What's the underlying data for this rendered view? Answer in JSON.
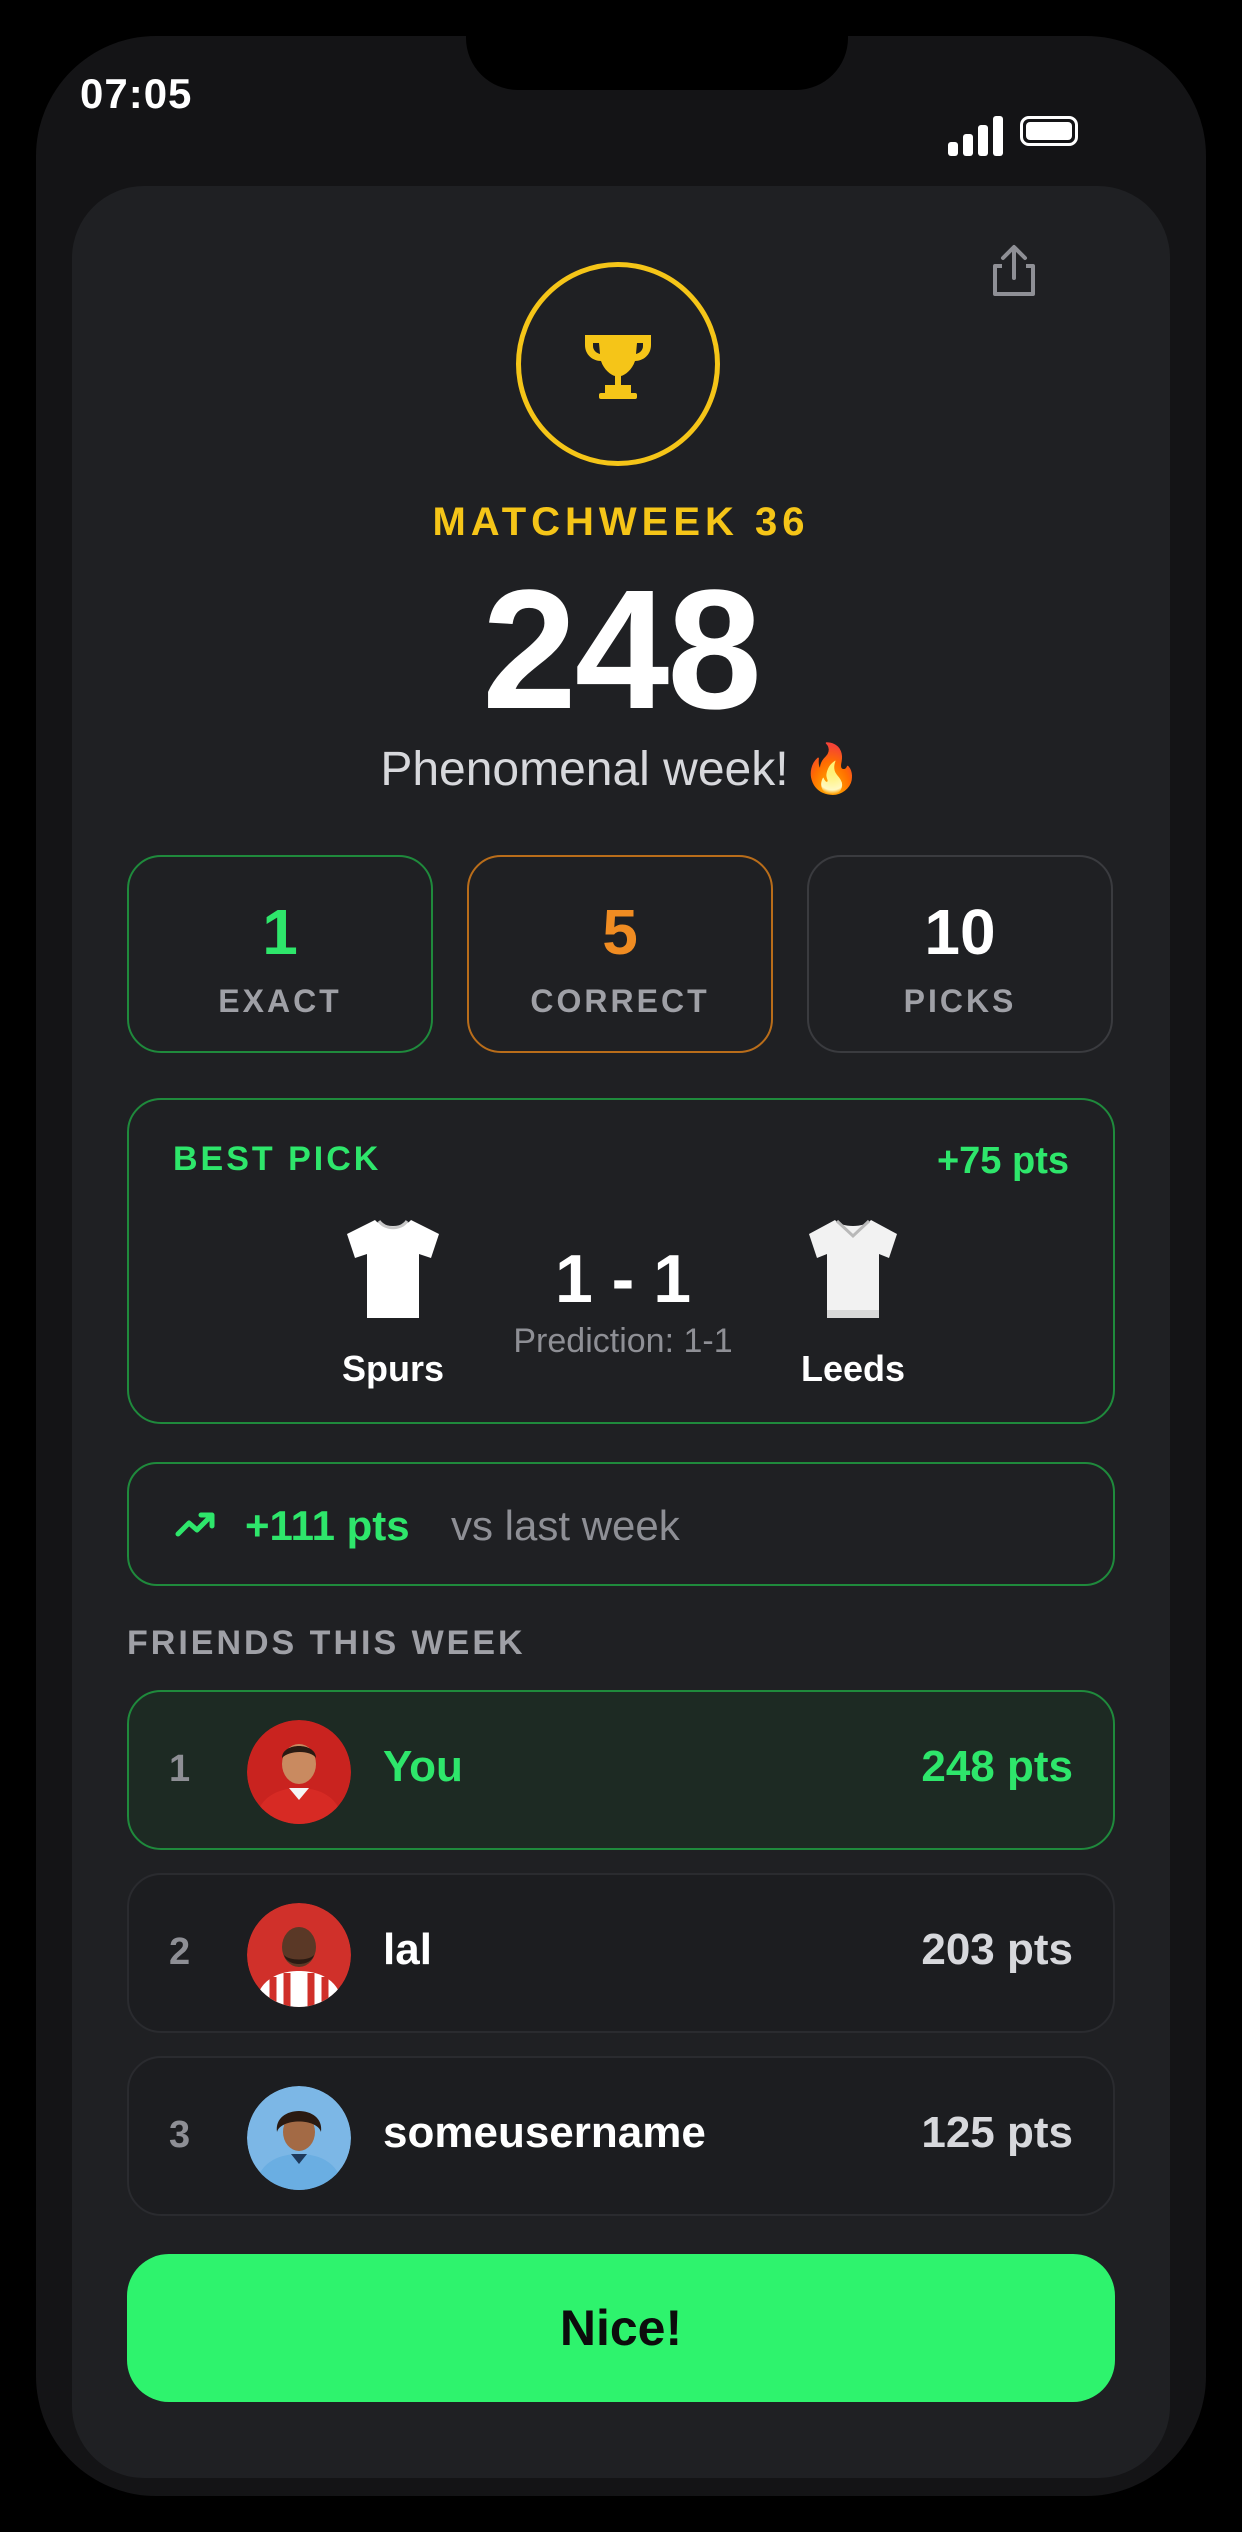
{
  "status_bar": {
    "time": "07:05"
  },
  "header": {
    "matchweek": "MATCHWEEK 36",
    "score": "248",
    "tagline": "Phenomenal week! 🔥",
    "trophy_icon": "trophy-icon",
    "share_icon": "share-icon"
  },
  "stats": [
    {
      "value": "1",
      "label": "EXACT",
      "color": "#2ee66b"
    },
    {
      "value": "5",
      "label": "CORRECT",
      "color": "#f08c22"
    },
    {
      "value": "10",
      "label": "PICKS",
      "color": "#ffffff"
    }
  ],
  "best_pick": {
    "title": "BEST PICK",
    "points": "+75 pts",
    "home_team": "Spurs",
    "away_team": "Leeds",
    "score": "1 - 1",
    "prediction": "Prediction: 1-1"
  },
  "delta": {
    "points": "+111 pts",
    "text": "vs last week",
    "icon": "trend-up-icon"
  },
  "friends": {
    "heading": "FRIENDS THIS WEEK",
    "rows": [
      {
        "rank": "1",
        "name": "You",
        "points": "248 pts"
      },
      {
        "rank": "2",
        "name": "lal",
        "points": "203 pts"
      },
      {
        "rank": "3",
        "name": "someusername",
        "points": "125 pts"
      }
    ]
  },
  "cta": {
    "label": "Nice!"
  },
  "colors": {
    "accent_green": "#2ef36d",
    "gold": "#f5c518",
    "orange": "#f08c22",
    "card_bg": "#1f2023"
  }
}
